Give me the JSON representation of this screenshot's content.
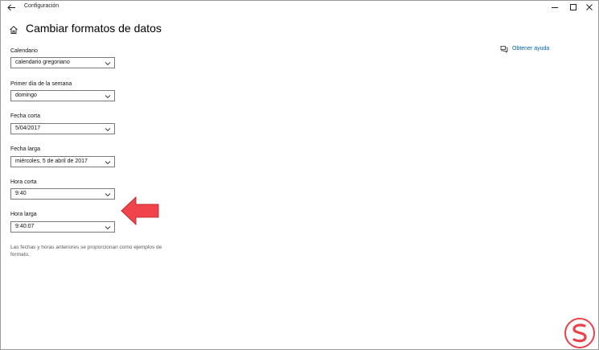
{
  "window": {
    "title": "Configuración"
  },
  "header": {
    "title": "Cambiar formatos de datos"
  },
  "fields": [
    {
      "label": "Calendario",
      "value": "calendario gregoriano"
    },
    {
      "label": "Primer día de la semana",
      "value": "domingo"
    },
    {
      "label": "Fecha corta",
      "value": "5/04/2017"
    },
    {
      "label": "Fecha larga",
      "value": "miércoles, 5 de abril de 2017"
    },
    {
      "label": "Hora corta",
      "value": "9:40"
    },
    {
      "label": "Hora larga",
      "value": "9:40:07"
    }
  ],
  "footnote": "Las fechas y horas anteriores se proporcionan como ejemplos de formato.",
  "help": {
    "label": "Obtener ayuda",
    "icon": "chat-help-icon"
  },
  "colors": {
    "link": "#0063b1",
    "annotation_arrow": "#f0434b",
    "watermark": "#e8424b"
  }
}
